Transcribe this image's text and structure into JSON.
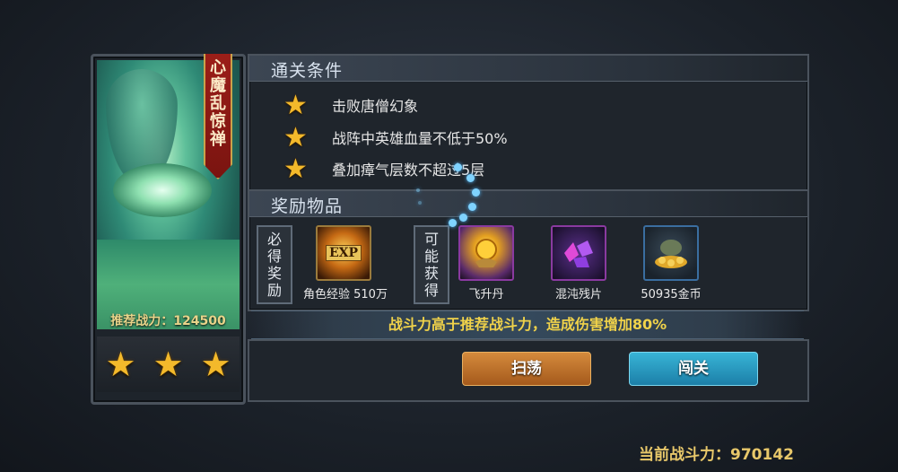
{
  "stage": {
    "name_chars": [
      "心",
      "魔",
      "乱",
      "惊",
      "禅"
    ],
    "recommended_power": "推荐战力：124500",
    "stars_earned": 3
  },
  "conditions": {
    "title": "通关条件",
    "items": [
      {
        "text": "击败唐僧幻象"
      },
      {
        "text": "战阵中英雄血量不低于50%"
      },
      {
        "text": "叠加瘴气层数不超过5层"
      }
    ]
  },
  "rewards": {
    "title": "奖励物品",
    "guaranteed_tag": [
      "必",
      "得",
      "奖",
      "励"
    ],
    "possible_tag": [
      "可",
      "能",
      "获",
      "得"
    ],
    "guaranteed": [
      {
        "label": "角色经验 510万",
        "icon": "exp-icon",
        "icon_text": "EXP"
      }
    ],
    "possible": [
      {
        "label": "飞升丹",
        "icon": "ascension-pill-icon"
      },
      {
        "label": "混沌残片",
        "icon": "chaos-fragment-icon"
      },
      {
        "label": "50935金币",
        "icon": "gold-coins-icon"
      }
    ]
  },
  "notice": "战斗力高于推荐战斗力，造成伤害增加80%",
  "buttons": {
    "sweep": "扫荡",
    "fight": "闯关"
  },
  "current_power": "当前战斗力：970142",
  "colors": {
    "gold": "#f3b92b",
    "notice": "#f0d24a",
    "sweep": "#c0742c",
    "fight": "#2a9cc4"
  }
}
